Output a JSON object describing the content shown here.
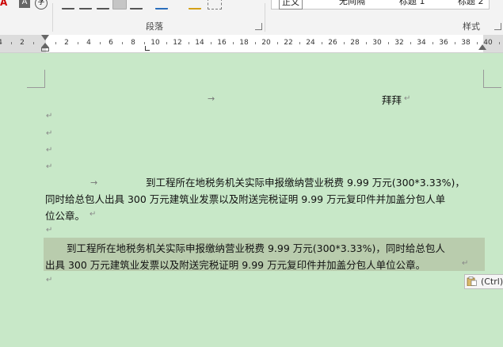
{
  "ribbon": {
    "paragraph_group_label": "段落",
    "styles_group_label": "样式",
    "styles": [
      "正文",
      "无间隔",
      "标题 1",
      "标题 2"
    ]
  },
  "ruler": {
    "labels": [
      "4",
      "2",
      "",
      "2",
      "4",
      "6",
      "8",
      "10",
      "12",
      "14",
      "16",
      "18",
      "20",
      "22",
      "24",
      "26",
      "28",
      "30",
      "32",
      "34",
      "36",
      "38",
      "40"
    ]
  },
  "document": {
    "line_heading": "拜拜",
    "para1_line1": "到工程所在地税务机关实际申报缴纳营业税费 9.99 万元(300*3.33%)，",
    "para1_line2": "同时给总包人出具 300 万元建筑业发票以及附送完税证明 9.99 万元复印件并加盖分包人单",
    "para1_line3": "位公章。",
    "para2_line1": "到工程所在地税务机关实际申报缴纳营业税费 9.99 万元(300*3.33%)，同时给总包人",
    "para2_line2": "出具 300 万元建筑业发票以及附送完税证明 9.99 万元复印件并加盖分包人单位公章。",
    "paste_options_label": "(Ctrl)"
  }
}
